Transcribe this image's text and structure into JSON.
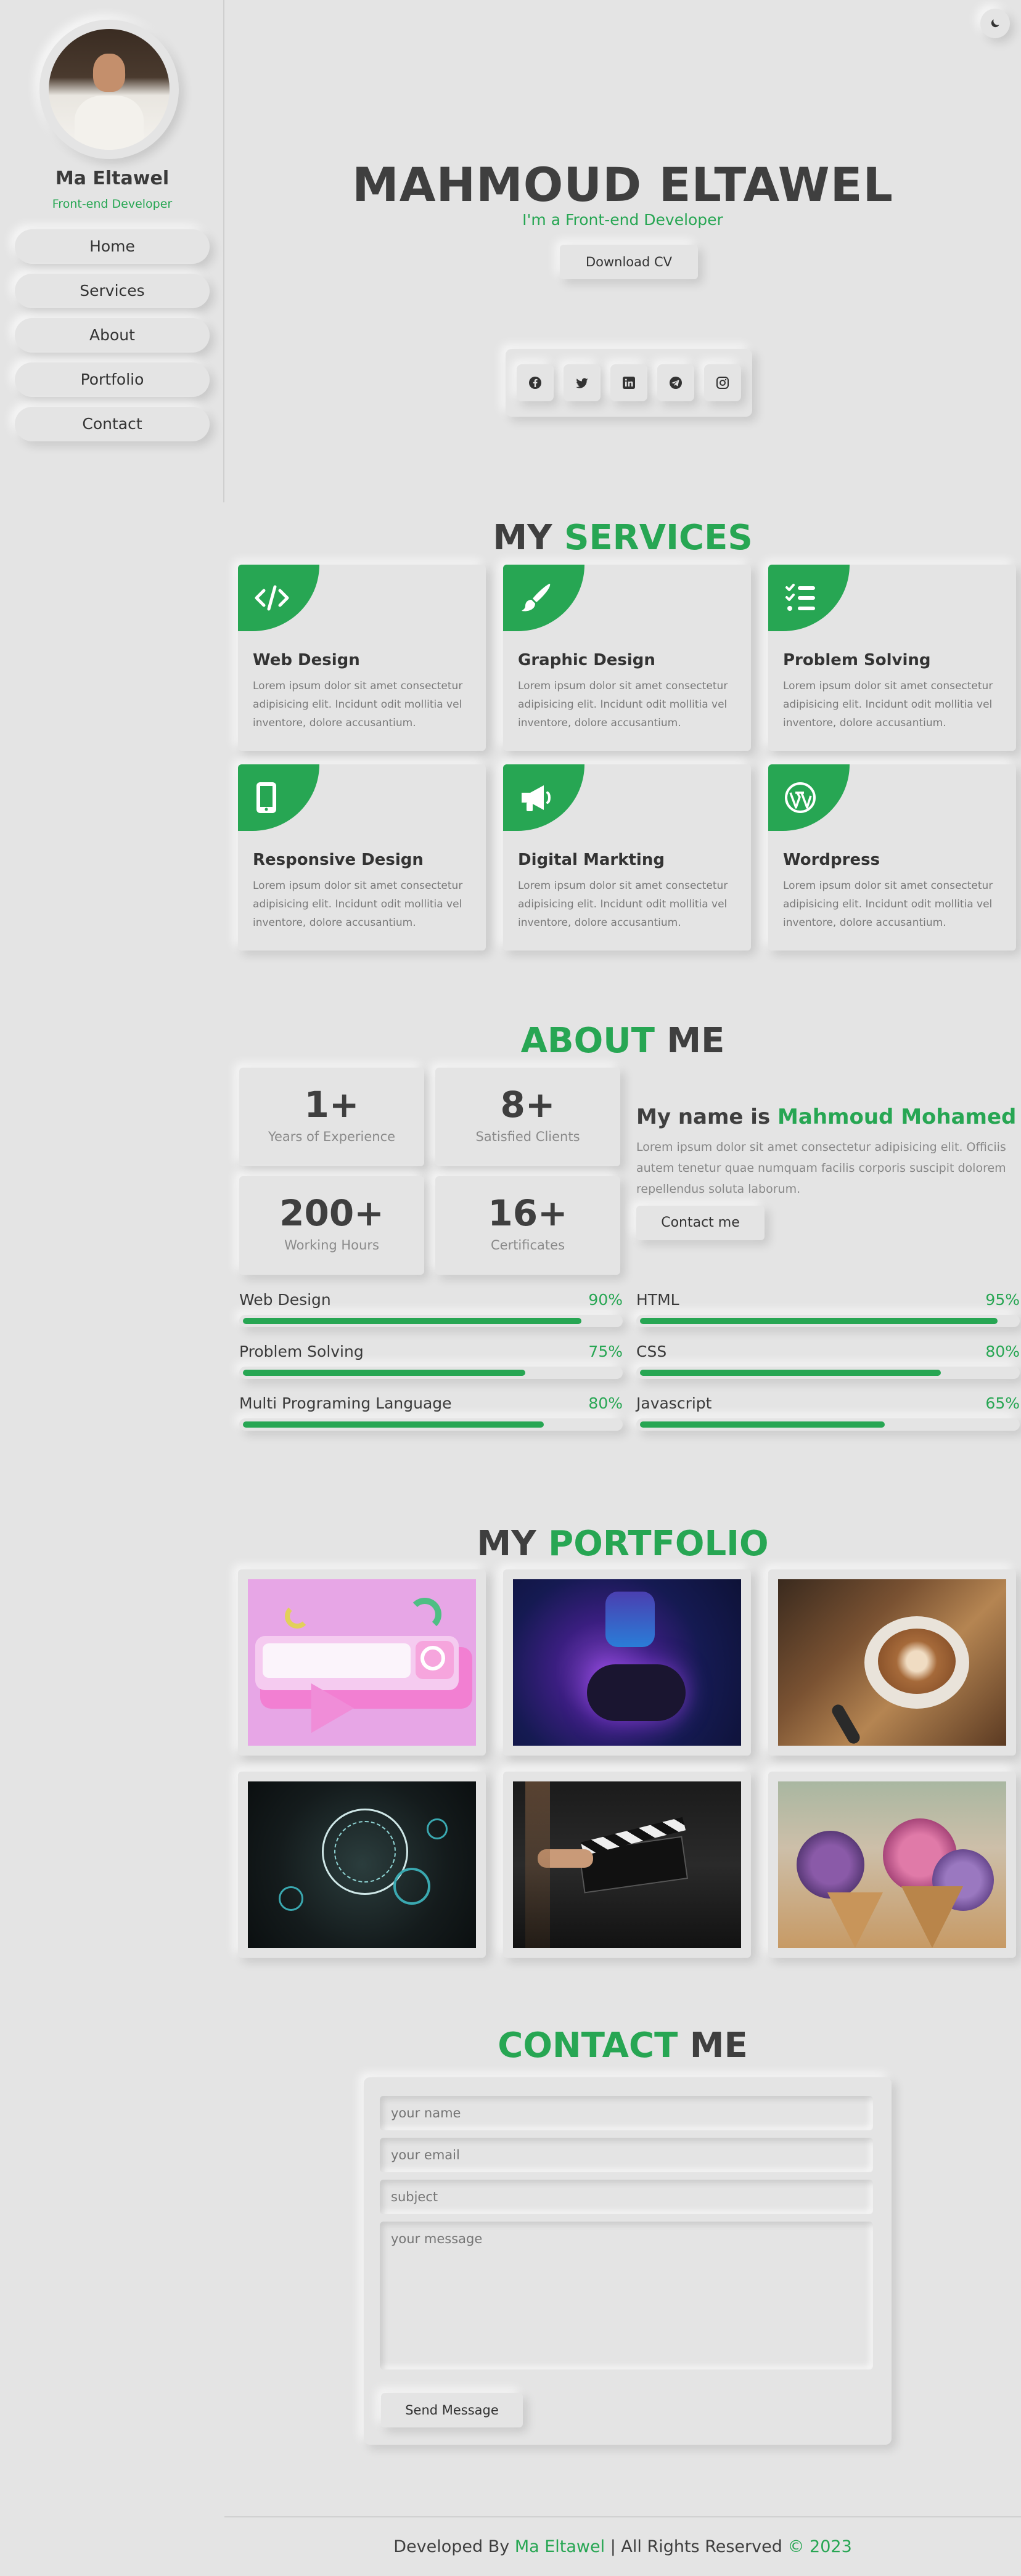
{
  "sidebar": {
    "name": "Ma Eltawel",
    "role": "Front-end Developer",
    "nav": [
      {
        "label": "Home"
      },
      {
        "label": "Services"
      },
      {
        "label": "About"
      },
      {
        "label": "Portfolio"
      },
      {
        "label": "Contact"
      }
    ]
  },
  "hero": {
    "name": "MAHMOUD ELTAWEL",
    "role": "I'm a Front-end Developer",
    "cv_label": "Download CV",
    "socials": [
      "facebook-icon",
      "twitter-icon",
      "linkedin-icon",
      "telegram-icon",
      "instagram-icon"
    ]
  },
  "services": {
    "title_a": "MY",
    "title_b": "SERVICES",
    "items": [
      {
        "icon": "code-icon",
        "title": "Web Design",
        "text": "Lorem ipsum dolor sit amet consectetur adipisicing elit. Incidunt odit mollitia vel inventore, dolore accusantium."
      },
      {
        "icon": "brush-icon",
        "title": "Graphic Design",
        "text": "Lorem ipsum dolor sit amet consectetur adipisicing elit. Incidunt odit mollitia vel inventore, dolore accusantium."
      },
      {
        "icon": "list-check-icon",
        "title": "Problem Solving",
        "text": "Lorem ipsum dolor sit amet consectetur adipisicing elit. Incidunt odit mollitia vel inventore, dolore accusantium."
      },
      {
        "icon": "mobile-icon",
        "title": "Responsive Design",
        "text": "Lorem ipsum dolor sit amet consectetur adipisicing elit. Incidunt odit mollitia vel inventore, dolore accusantium."
      },
      {
        "icon": "megaphone-icon",
        "title": "Digital Markting",
        "text": "Lorem ipsum dolor sit amet consectetur adipisicing elit. Incidunt odit mollitia vel inventore, dolore accusantium."
      },
      {
        "icon": "wordpress-icon",
        "title": "Wordpress",
        "text": "Lorem ipsum dolor sit amet consectetur adipisicing elit. Incidunt odit mollitia vel inventore, dolore accusantium."
      }
    ]
  },
  "about": {
    "title_a": "ABOUT",
    "title_b": "ME",
    "stats": [
      {
        "num": "1+",
        "label": "Years of Experience"
      },
      {
        "num": "8+",
        "label": "Satisfied Clients"
      },
      {
        "num": "200+",
        "label": "Working Hours"
      },
      {
        "num": "16+",
        "label": "Certificates"
      }
    ],
    "head_a": "My name is",
    "head_b": "Mahmoud Mohamed",
    "text": "Lorem ipsum dolor sit amet consectetur adipisicing elit. Officiis autem tenetur quae numquam facilis corporis suscipit dolorem repellendus soluta laborum.",
    "contact_label": "Contact me",
    "skills": [
      {
        "name": "Web Design",
        "pct": "90%",
        "value": 90
      },
      {
        "name": "HTML",
        "pct": "95%",
        "value": 95
      },
      {
        "name": "Problem Solving",
        "pct": "75%",
        "value": 75
      },
      {
        "name": "CSS",
        "pct": "80%",
        "value": 80
      },
      {
        "name": "Multi Programing Language",
        "pct": "80%",
        "value": 80
      },
      {
        "name": "Javascript",
        "pct": "65%",
        "value": 65
      }
    ]
  },
  "portfolio": {
    "title_a": "MY",
    "title_b": "PORTFOLIO",
    "items": [
      {
        "name": "search-3d-image"
      },
      {
        "name": "gamepad-image"
      },
      {
        "name": "coffee-image"
      },
      {
        "name": "training-image"
      },
      {
        "name": "clapperboard-image"
      },
      {
        "name": "flowers-image"
      }
    ]
  },
  "contact": {
    "title_a": "CONTACT",
    "title_b": "ME",
    "name_ph": "your name",
    "email_ph": "your email",
    "subject_ph": "subject",
    "message_ph": "your message",
    "send_label": "Send Message"
  },
  "footer": {
    "a": "Developed By",
    "b": "Ma Eltawel",
    "c": "| All Rights Reserved",
    "d": "© 2023"
  },
  "colors": {
    "accent": "#27a653",
    "background": "#e4e4e4",
    "text": "#3c3c3c"
  }
}
